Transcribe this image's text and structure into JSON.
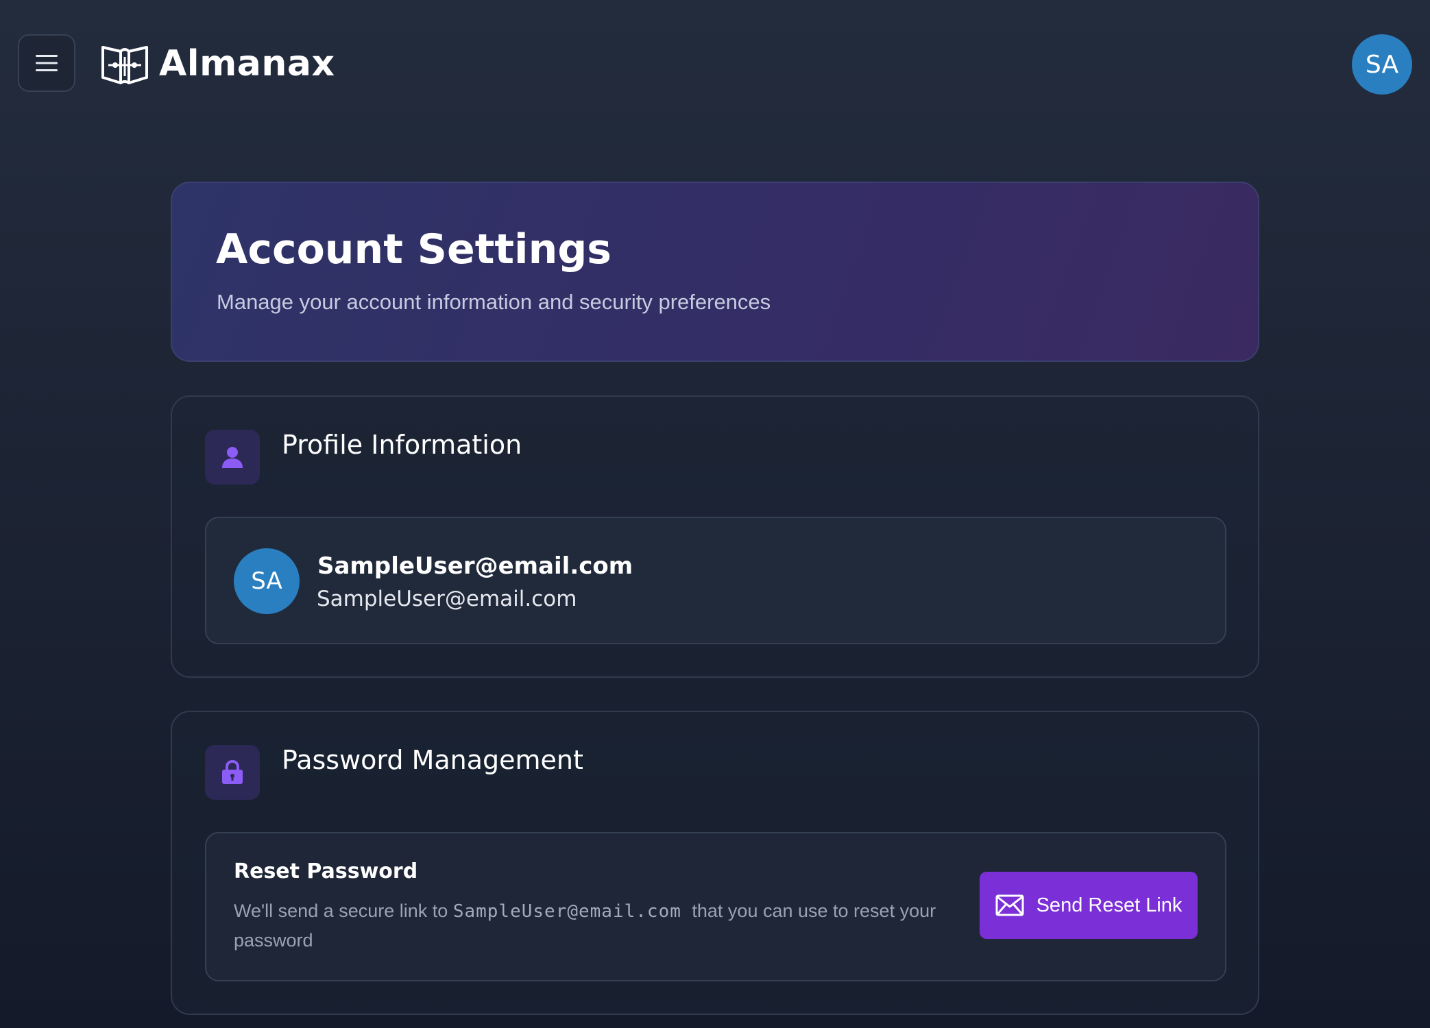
{
  "header": {
    "menu_icon": "hamburger-menu-icon",
    "brand_icon": "book-map-icon",
    "brand_name": "Almanax",
    "user_initials": "SA"
  },
  "hero": {
    "title": "Account Settings",
    "subtitle": "Manage your account information and security preferences"
  },
  "profile": {
    "section_title": "Profile Information",
    "section_icon": "user-icon",
    "avatar_initials": "SA",
    "display_name": "SampleUser@email.com",
    "email": "SampleUser@email.com"
  },
  "password": {
    "section_title": "Password Management",
    "section_icon": "lock-icon",
    "reset_title": "Reset Password",
    "desc_before": "We'll send a secure link to ",
    "desc_email": "SampleUser@email.com",
    "desc_after": " that you can use to reset your password",
    "button_label": "Send Reset Link",
    "button_icon": "mail-icon"
  },
  "colors": {
    "accent": "#7b2fd6",
    "avatar": "#2a7fc0",
    "icon_purple": "#8b5cf6"
  }
}
